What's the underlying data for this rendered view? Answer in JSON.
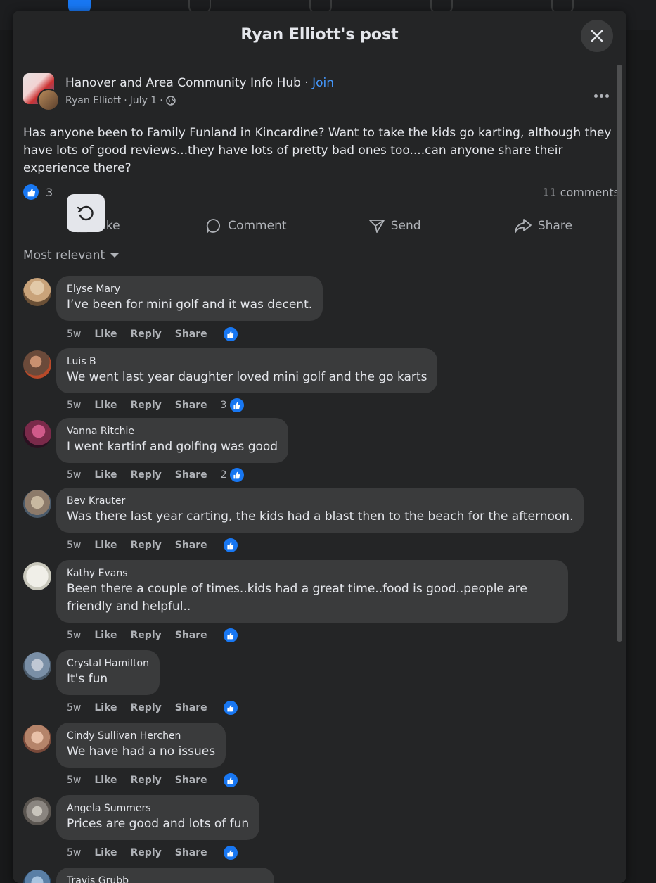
{
  "modal": {
    "title": "Ryan Elliott's post"
  },
  "post": {
    "group_name": "Hanover and Area Community Info Hub",
    "separator": " · ",
    "join_label": "Join",
    "author": "Ryan Elliott",
    "date": "July 1",
    "dot": "·",
    "text": "Has anyone been to Family Funland in Kincardine? Want to take the kids go karting, although they have lots of good reviews...they have lots of pretty bad ones too....can anyone share their experience there?",
    "reaction_count": "3",
    "comments_count": "11 comments"
  },
  "actions": {
    "like": "Like",
    "comment": "Comment",
    "send": "Send",
    "share": "Share"
  },
  "sort_label": "Most relevant",
  "comment_actions": {
    "like": "Like",
    "reply": "Reply",
    "share": "Share"
  },
  "comments": [
    {
      "author": "Elyse Mary",
      "text": "I’ve been for mini golf and it was decent.",
      "time": "5w",
      "likes": "",
      "avatar_color": "#c9a37a"
    },
    {
      "author": "Luis B",
      "text": "We went last year daughter loved mini golf and the go karts",
      "time": "5w",
      "likes": "3",
      "avatar_color": "#6b4a3a"
    },
    {
      "author": "Vanna Ritchie",
      "text": "I went kartinf and golfing was good",
      "time": "5w",
      "likes": "2",
      "avatar_color": "#7a2a4a"
    },
    {
      "author": "Bev Krauter",
      "text": "Was there last year carting, the kids had a blast then to the beach for the afternoon.",
      "time": "5w",
      "likes": "",
      "avatar_color": "#8c7a6a"
    },
    {
      "author": "Kathy Evans",
      "text": "Been there a couple of times..kids had a great time..food is good..people are friendly and helpful..",
      "time": "5w",
      "likes": "",
      "avatar_color": "#e8e8e0"
    },
    {
      "author": "Crystal Hamilton",
      "text": "It's fun",
      "time": "5w",
      "likes": "",
      "avatar_color": "#7a8fa6"
    },
    {
      "author": "Cindy Sullivan Herchen",
      "text": "We have had a no issues",
      "time": "5w",
      "likes": "",
      "avatar_color": "#b5846a"
    },
    {
      "author": "Angela Summers",
      "text": "Prices are good and lots of fun",
      "time": "5w",
      "likes": "",
      "avatar_color": "#8a8580"
    },
    {
      "author": "Travis Grubb",
      "text": "",
      "time": "",
      "likes": "",
      "avatar_color": "#5a7fa6"
    }
  ]
}
